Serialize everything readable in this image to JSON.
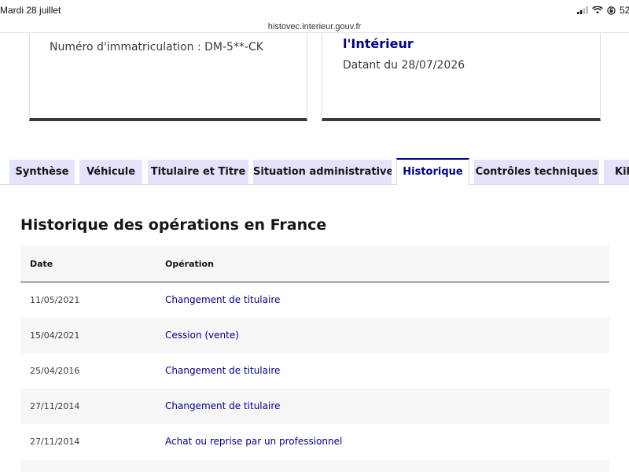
{
  "status_bar": {
    "time_date": "Mardi 28 juillet",
    "battery": "52"
  },
  "browser": {
    "url": "histovec.interieur.gouv.fr"
  },
  "cards": {
    "left": {
      "plate_label": "Numéro d'immatriculation : DM-5**-CK"
    },
    "right": {
      "ministry": "l'Intérieur",
      "issued": "Datant du 28/07/2026"
    }
  },
  "tabs": [
    {
      "label": "Synthèse",
      "active": false
    },
    {
      "label": "Véhicule",
      "active": false
    },
    {
      "label": "Titulaire et Titre",
      "active": false
    },
    {
      "label": "Situation administrative",
      "active": false
    },
    {
      "label": "Historique",
      "active": true
    },
    {
      "label": "Contrôles techniques",
      "active": false
    },
    {
      "label": "Kilo",
      "active": false
    }
  ],
  "history": {
    "title": "Historique des opérations en France",
    "columns": [
      "Date",
      "Opération"
    ],
    "rows": [
      {
        "date": "11/05/2021",
        "operation": "Changement de titulaire"
      },
      {
        "date": "15/04/2021",
        "operation": "Cession (vente)"
      },
      {
        "date": "25/04/2016",
        "operation": "Changement de titulaire"
      },
      {
        "date": "27/11/2014",
        "operation": "Changement de titulaire"
      },
      {
        "date": "27/11/2014",
        "operation": "Achat ou reprise par un professionnel"
      }
    ]
  },
  "colors": {
    "accent": "#000091",
    "tab_bg": "#e3e3fd",
    "row_alt": "#f6f6f6"
  }
}
